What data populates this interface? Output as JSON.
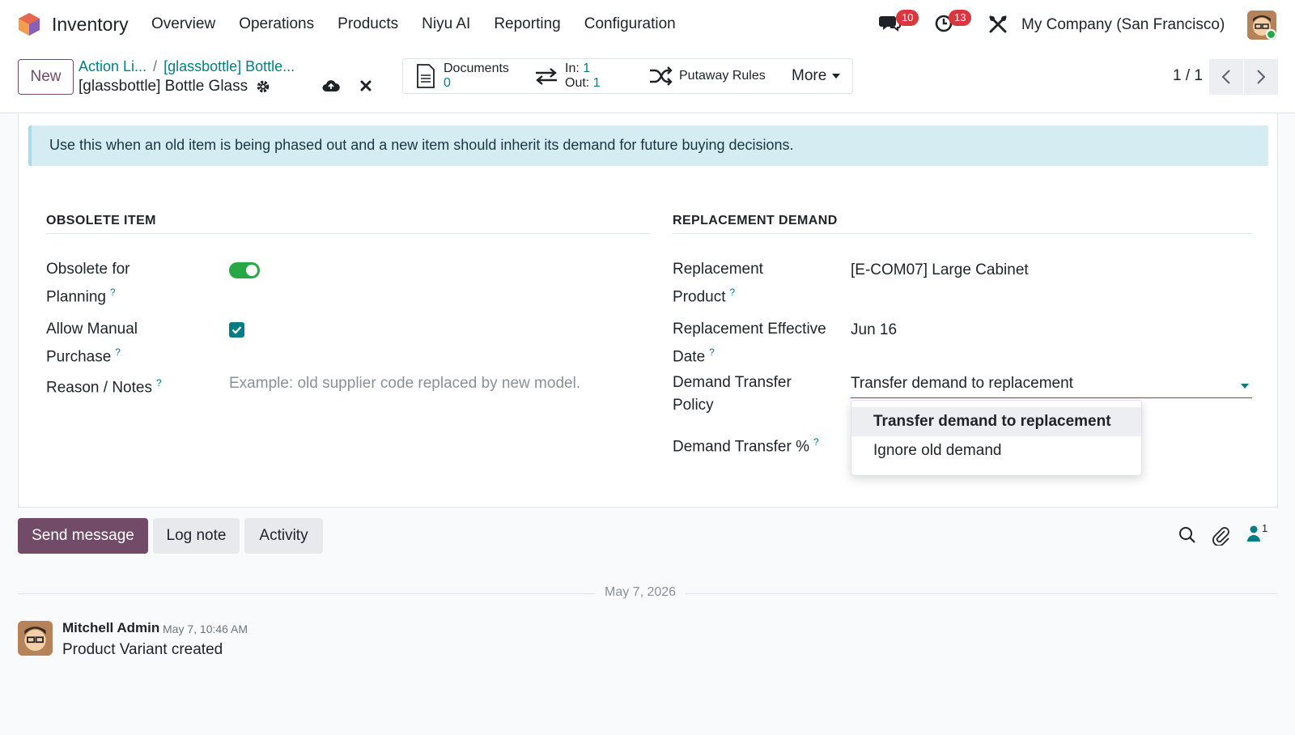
{
  "app": {
    "name": "Inventory"
  },
  "nav": [
    "Overview",
    "Operations",
    "Products",
    "Niyu AI",
    "Reporting",
    "Configuration"
  ],
  "systray": {
    "messages_count": "10",
    "activities_count": "13",
    "company": "My Company (San Francisco)"
  },
  "control": {
    "new_label": "New",
    "breadcrumb": [
      "Action Li...",
      "[glassbottle] Bottle..."
    ],
    "record_title": "[glassbottle] Bottle Glass",
    "documents_label": "Documents",
    "documents_count": "0",
    "in_label": "In:",
    "in_count": "1",
    "out_label": "Out:",
    "out_count": "1",
    "putaway_label": "Putaway Rules",
    "more_label": "More",
    "pager": "1 / 1"
  },
  "form": {
    "alert": "Use this when an old item is being phased out and a new item should inherit its demand for future buying decisions.",
    "left_group": {
      "title": "OBSOLETE ITEM",
      "obsolete_label_1": "Obsolete for",
      "obsolete_label_2": "Planning",
      "obsolete_value": true,
      "manual_label_1": "Allow Manual",
      "manual_label_2": "Purchase",
      "manual_value": true,
      "reason_label": "Reason / Notes",
      "reason_placeholder": "Example: old supplier code replaced by new model."
    },
    "right_group": {
      "title": "REPLACEMENT DEMAND",
      "product_label_1": "Replacement",
      "product_label_2": "Product",
      "product_value": "[E-COM07] Large Cabinet",
      "date_label_1": "Replacement Effective",
      "date_label_2": "Date",
      "date_value": "Jun 16",
      "policy_label_1": "Demand Transfer",
      "policy_label_2": "Policy",
      "policy_value": "Transfer demand to replacement",
      "percent_label": "Demand Transfer %",
      "policy_options": [
        "Transfer demand to replacement",
        "Ignore old demand"
      ]
    },
    "help_mark": "?"
  },
  "chatter": {
    "send_label": "Send message",
    "log_label": "Log note",
    "activity_label": "Activity",
    "followers_count": "1",
    "date_separator": "May 7, 2026",
    "message": {
      "author": "Mitchell Admin",
      "time": "May 7, 10:46 AM",
      "body": "Product Variant created"
    }
  },
  "colors": {
    "brand": "#714b67",
    "accent": "#017e84",
    "toggle_on": "#28a745",
    "badge": "#d9363e",
    "alert_bg": "#d4ecf2"
  }
}
